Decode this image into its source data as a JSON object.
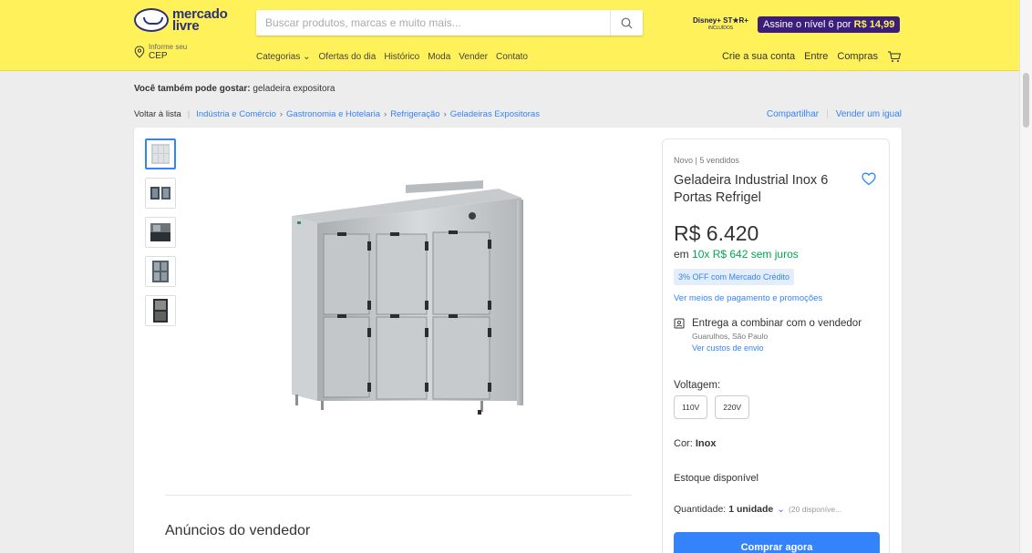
{
  "header": {
    "logo_line1": "mercado",
    "logo_line2": "livre",
    "search_placeholder": "Buscar produtos, marcas e muito mais...",
    "promo_brand": "Disney+ ST★R+",
    "promo_included": "INCLUÍDOS",
    "promo_label": "Assine o nível 6 por",
    "promo_price": "R$ 14,99",
    "cep_small": "Informe seu",
    "cep_big": "CEP",
    "nav": [
      "Categorias ⌄",
      "Ofertas do dia",
      "Histórico",
      "Moda",
      "Vender",
      "Contato"
    ],
    "account": [
      "Crie a sua conta",
      "Entre",
      "Compras"
    ]
  },
  "related": {
    "label": "Você também pode gostar:",
    "value": "geladeira expositora"
  },
  "breadcrumb": {
    "back": "Voltar à lista",
    "items": [
      "Indústria e Comércio",
      "Gastronomia e Hotelaria",
      "Refrigeração",
      "Geladeiras Expositoras"
    ]
  },
  "share": {
    "share": "Compartilhar",
    "sell": "Vender um igual"
  },
  "product": {
    "condition": "Novo  |  5 vendidos",
    "title": "Geladeira Industrial Inox 6 Portas Refrigel",
    "price": "R$ 6.420",
    "installments_prefix": "em ",
    "installments_value": "10x R$ 642 sem juros",
    "off_badge": "3% OFF com Mercado Crédito",
    "payment_link": "Ver meios de pagamento e promoções",
    "shipping_main": "Entrega a combinar com o vendedor",
    "shipping_location": "Guarulhos, São Paulo",
    "shipping_link": "Ver custos de envio",
    "voltage_label": "Voltagem:",
    "voltages": [
      "110V",
      "220V"
    ],
    "color_label": "Cor:",
    "color_value": "Inox",
    "stock": "Estoque disponível",
    "qty_label": "Quantidade:",
    "qty_value": "1 unidade",
    "qty_avail": "(20 disponíve...",
    "buy_button": "Comprar agora"
  },
  "seller_section": "Anúncios do vendedor",
  "colors": {
    "header_bg": "#fff159",
    "accent": "#3483fa",
    "green": "#00a650"
  }
}
